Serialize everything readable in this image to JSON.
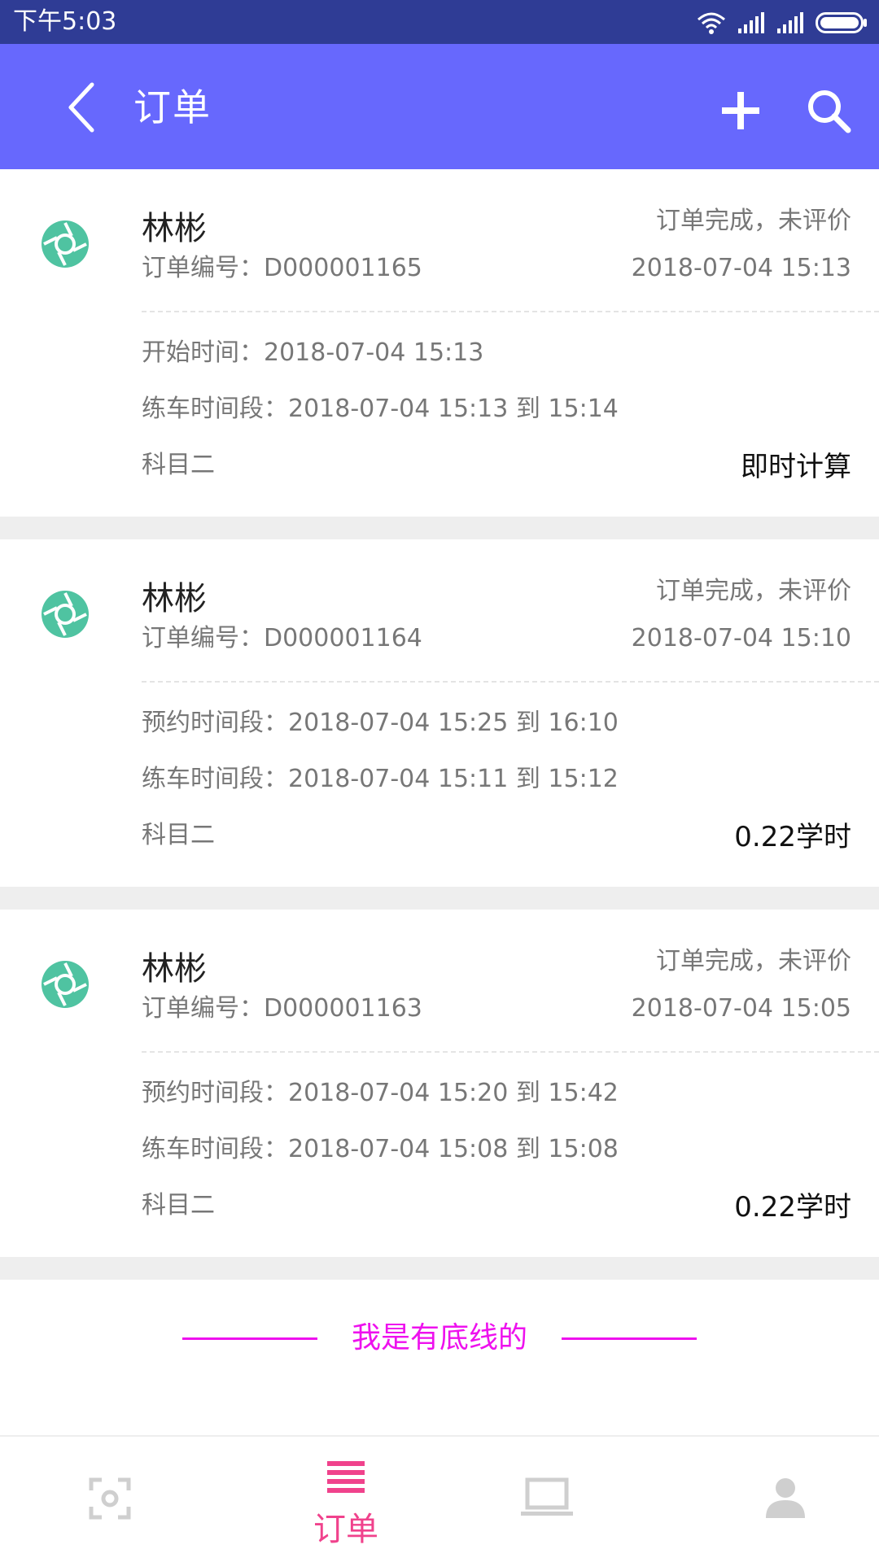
{
  "status_bar": {
    "time": "下午5:03"
  },
  "app_bar": {
    "title": "订单",
    "back_icon": "back-chevron-icon",
    "add_icon": "plus-icon",
    "search_icon": "search-icon",
    "background": "#6768fd"
  },
  "orders": [
    {
      "name": "林彬",
      "order_no": "订单编号：D000001165",
      "status": "订单完成，未评价",
      "date": "2018-07-04 15:13",
      "line1": "开始时间：2018-07-04 15:13",
      "line2": "练车时间段：2018-07-04 15:13 到 15:14",
      "subject": "科目二",
      "amount": "即时计算"
    },
    {
      "name": "林彬",
      "order_no": "订单编号：D000001164",
      "status": "订单完成，未评价",
      "date": "2018-07-04 15:10",
      "line1": "预约时间段：2018-07-04 15:25 到 16:10",
      "line2": "练车时间段：2018-07-04 15:11 到 15:12",
      "subject": "科目二",
      "amount": "0.22学时"
    },
    {
      "name": "林彬",
      "order_no": "订单编号：D000001163",
      "status": "订单完成，未评价",
      "date": "2018-07-04 15:05",
      "line1": "预约时间段：2018-07-04 15:20 到 15:42",
      "line2": "练车时间段：2018-07-04 15:08 到 15:08",
      "subject": "科目二",
      "amount": "0.22学时"
    }
  ],
  "bottom_line": {
    "text": "我是有底线的",
    "color": "#ee11ee"
  },
  "bottom_nav": {
    "scan_icon": "scan-icon",
    "orders_icon": "list-icon",
    "orders_label": "订单",
    "device_icon": "laptop-icon",
    "profile_icon": "person-icon",
    "active_color": "#f0428c",
    "inactive_color": "#cfcfcf"
  },
  "colors": {
    "status_bar": "#2f3c95",
    "avatar": "#4fc3a1"
  }
}
